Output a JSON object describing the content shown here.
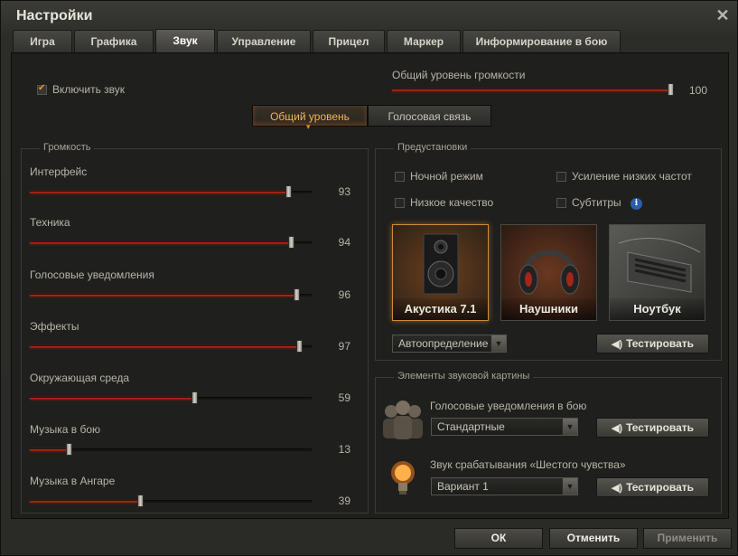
{
  "window": {
    "title": "Настройки"
  },
  "tabs": [
    {
      "label": "Игра"
    },
    {
      "label": "Графика"
    },
    {
      "label": "Звук"
    },
    {
      "label": "Управление"
    },
    {
      "label": "Прицел"
    },
    {
      "label": "Маркер"
    },
    {
      "label": "Информирование в бою"
    }
  ],
  "active_tab": "Звук",
  "top": {
    "enable_sound_label": "Включить звук",
    "enable_sound_checked": true,
    "master_label": "Общий уровень громкости",
    "master_value": "100",
    "master_level": 100
  },
  "segments": [
    {
      "label": "Общий уровень"
    },
    {
      "label": "Голосовая связь"
    }
  ],
  "volume": {
    "title": "Громкость",
    "sliders": [
      {
        "label": "Интерфейс",
        "value": "93",
        "level": 93
      },
      {
        "label": "Техника",
        "value": "94",
        "level": 94
      },
      {
        "label": "Голосовые уведомления",
        "value": "96",
        "level": 96
      },
      {
        "label": "Эффекты",
        "value": "97",
        "level": 97
      },
      {
        "label": "Окружающая среда",
        "value": "59",
        "level": 59
      },
      {
        "label": "Музыка в бою",
        "value": "13",
        "level": 13
      },
      {
        "label": "Музыка в Ангаре",
        "value": "39",
        "level": 39
      }
    ]
  },
  "presets": {
    "title": "Предустановки",
    "options": [
      {
        "label": "Ночной режим",
        "checked": false
      },
      {
        "label": "Усиление низких частот",
        "checked": false
      },
      {
        "label": "Низкое качество",
        "checked": false
      },
      {
        "label": "Субтитры",
        "checked": false
      }
    ],
    "cards": [
      {
        "label": "Акустика 7.1",
        "icon": "speaker-icon",
        "active": true
      },
      {
        "label": "Наушники",
        "icon": "headphones-icon",
        "active": false
      },
      {
        "label": "Ноутбук",
        "icon": "laptop-icon",
        "active": false
      }
    ],
    "device_select": "Автоопределение",
    "test_label": "Тестировать"
  },
  "elements": {
    "title": "Элементы звуковой картины",
    "voice_label": "Голосовые уведомления в бою",
    "voice_select": "Стандартные",
    "sixth_label": "Звук срабатывания «Шестого чувства»",
    "sixth_select": "Вариант 1",
    "test_label": "Тестировать"
  },
  "footer": {
    "ok": "ОК",
    "cancel": "Отменить",
    "apply": "Применить"
  },
  "colors": {
    "accent": "#f2b45c",
    "slider_fill": "#c42a18",
    "info": "#2b5ea8"
  }
}
